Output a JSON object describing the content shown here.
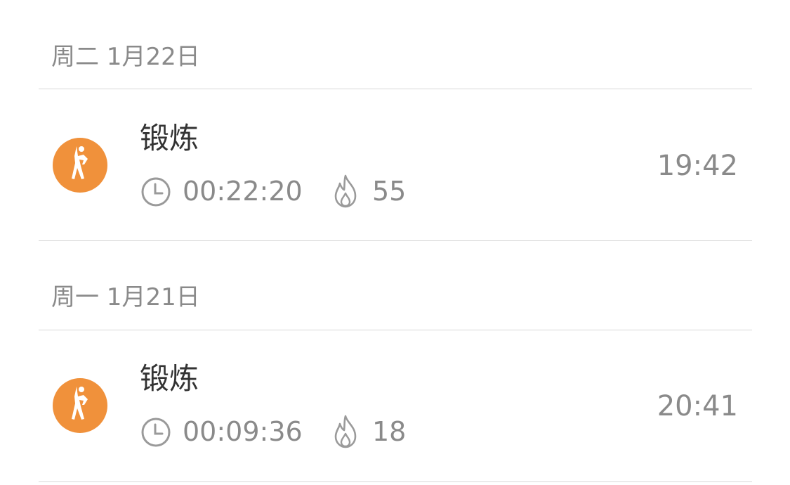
{
  "days": [
    {
      "header": "周二 1月22日",
      "records": [
        {
          "title": "锻炼",
          "duration": "00:22:20",
          "calories": "55",
          "time": "19:42",
          "icon": "exercise-icon"
        }
      ]
    },
    {
      "header": "周一 1月21日",
      "records": [
        {
          "title": "锻炼",
          "duration": "00:09:36",
          "calories": "18",
          "time": "20:41",
          "icon": "exercise-icon"
        }
      ]
    }
  ],
  "colors": {
    "accent": "#f0913b",
    "text_primary": "#333333",
    "text_secondary": "#8a8a8a",
    "divider": "#d8d8d8"
  }
}
